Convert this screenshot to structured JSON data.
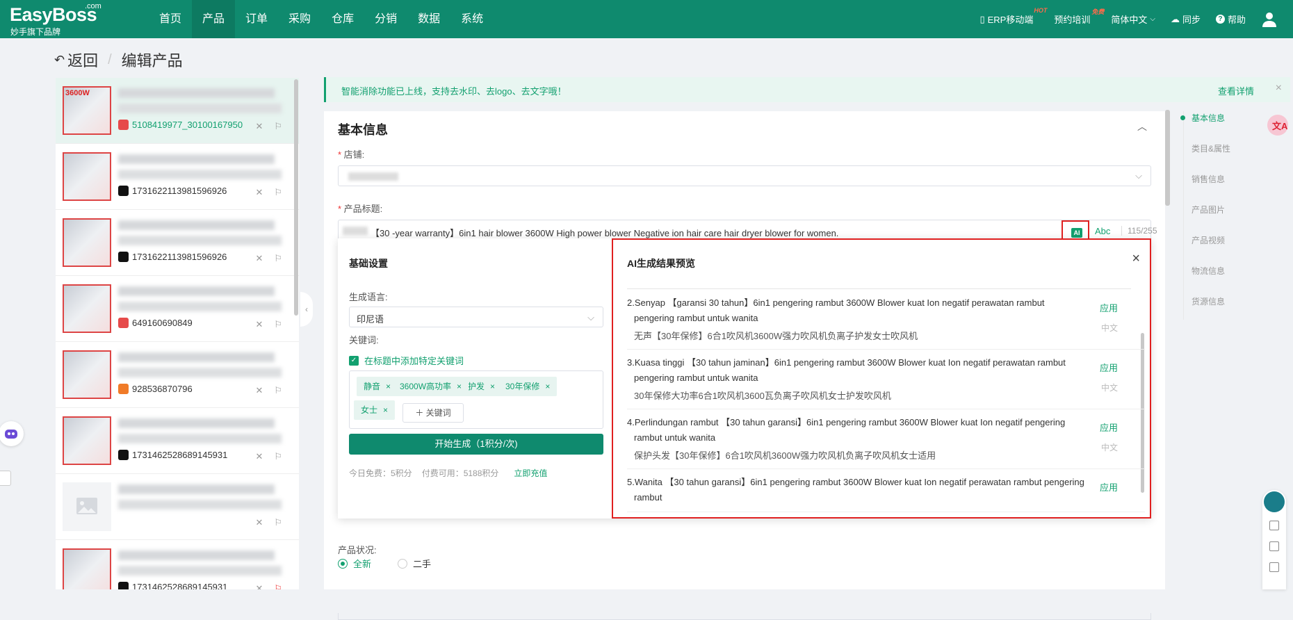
{
  "brand": {
    "name": "EasyBoss",
    "com": ".com",
    "sub": "妙手旗下品牌"
  },
  "nav": [
    "首页",
    "产品",
    "订单",
    "采购",
    "仓库",
    "分销",
    "数据",
    "系统"
  ],
  "nav_active": 1,
  "topright": {
    "erp": "ERP移动端",
    "erp_badge": "HOT",
    "training": "预约培训",
    "training_badge": "免费",
    "lang": "简体中文",
    "sync": "同步",
    "help": "帮助"
  },
  "page": {
    "back": "返回",
    "title": "编辑产品"
  },
  "products": [
    {
      "id": "5108419977_30100167950",
      "platform_color": "#e64a4a",
      "green": true,
      "active": true,
      "thumb_text": "3600W"
    },
    {
      "id": "1731622113981596926",
      "platform_color": "#111111",
      "green": false,
      "active": false,
      "thumb_text": ""
    },
    {
      "id": "1731622113981596926",
      "platform_color": "#111111",
      "green": false,
      "active": false,
      "thumb_text": ""
    },
    {
      "id": "649160690849",
      "platform_color": "#e64a4a",
      "green": false,
      "active": false,
      "thumb_text": ""
    },
    {
      "id": "928536870796",
      "platform_color": "#f07b28",
      "green": false,
      "active": false,
      "thumb_text": ""
    },
    {
      "id": "1731462528689145931",
      "platform_color": "#111111",
      "green": false,
      "active": false,
      "thumb_text": ""
    },
    {
      "id": "",
      "platform_color": "",
      "green": false,
      "active": false,
      "thumb_text": ""
    },
    {
      "id": "1731462528689145931",
      "platform_color": "#111111",
      "green": false,
      "active": false,
      "thumb_text": ""
    }
  ],
  "notice": {
    "text": "智能消除功能已上线，支持去水印、去logo、去文字哦！",
    "more": "查看详情"
  },
  "card": {
    "title": "基本信息",
    "shop_label": "店铺:",
    "title_label": "产品标题:",
    "title_value": "【30 -year warranty】6in1 hair blower 3600W High power blower Negative ion hair care hair dryer blower for women.",
    "ai_label": "AI",
    "abc_label": "Abc",
    "char_count": "115/255",
    "condition_label": "产品状况:",
    "condition_new": "全新",
    "condition_used": "二手"
  },
  "popup": {
    "left_title": "基础设置",
    "lang_label": "生成语言:",
    "lang_value": "印尼语",
    "kw_label": "关键词:",
    "kw_check": "在标题中添加特定关键词",
    "tags": [
      "静音",
      "3600W高功率",
      "护发",
      "30年保修",
      "女士"
    ],
    "add_kw": "＋ 关键词",
    "gen_button": "开始生成（1积分/次)",
    "free": "今日免费：5积分",
    "paid": "付费可用：5188积分",
    "recharge": "立即充值",
    "right_title": "AI生成结果预览",
    "apply": "应用",
    "zh": "中文",
    "results": [
      {
        "en": "2.Senyap 【garansi 30 tahun】6in1 pengering rambut 3600W Blower kuat Ion negatif perawatan rambut pengering rambut untuk wanita",
        "zh": "无声【30年保修】6合1吹风机3600W强力吹风机负离子护发女士吹风机"
      },
      {
        "en": "3.Kuasa tinggi 【30 tahun jaminan】6in1 pengering rambut 3600W Blower kuat Ion negatif perawatan rambut pengering rambut untuk wanita",
        "zh": "30年保修大功率6合1吹风机3600瓦负离子吹风机女士护发吹风机"
      },
      {
        "en": "4.Perlindungan rambut 【30 tahun garansi】6in1 pengering rambut 3600W Blower kuat Ion negatif pengering rambut untuk wanita",
        "zh": "保护头发【30年保修】6合1吹风机3600W强力吹风机负离子吹风机女士适用"
      },
      {
        "en": "5.Wanita 【30 tahun garansi】6in1 pengering rambut 3600W Blower kuat Ion negatif perawatan rambut pengering rambut",
        "zh": ""
      }
    ]
  },
  "rightnav": [
    "基本信息",
    "类目&属性",
    "销售信息",
    "产品图片",
    "产品视频",
    "物流信息",
    "货源信息"
  ],
  "translate_icon": "文A"
}
